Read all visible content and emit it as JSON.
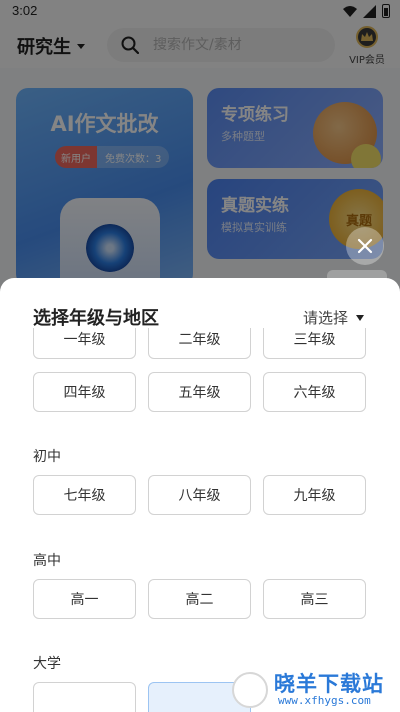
{
  "status_bar": {
    "time": "3:02"
  },
  "header": {
    "level": "研究生",
    "search_placeholder": "搜索作文/素材",
    "vip_label": "VIP会员"
  },
  "cards": {
    "ai": {
      "title": "AI作文批改",
      "tag_new": "新用户",
      "tag_free": "免费次数：3"
    },
    "special": {
      "title": "专项练习",
      "subtitle": "多种题型"
    },
    "exam": {
      "title": "真题实练",
      "subtitle": "模拟真实训练",
      "coin": "真题"
    }
  },
  "sheet": {
    "title": "选择年级与地区",
    "region_placeholder": "请选择",
    "rows_top": [
      "一年级",
      "二年级",
      "三年级"
    ],
    "rows_top2": [
      "四年级",
      "五年级",
      "六年级"
    ],
    "junior_label": "初中",
    "junior": [
      "七年级",
      "八年级",
      "九年级"
    ],
    "senior_label": "高中",
    "senior": [
      "高一",
      "高二",
      "高三"
    ],
    "college_label": "大学"
  },
  "watermark": {
    "text": "晓羊下载站",
    "url": "www.xfhygs.com"
  }
}
